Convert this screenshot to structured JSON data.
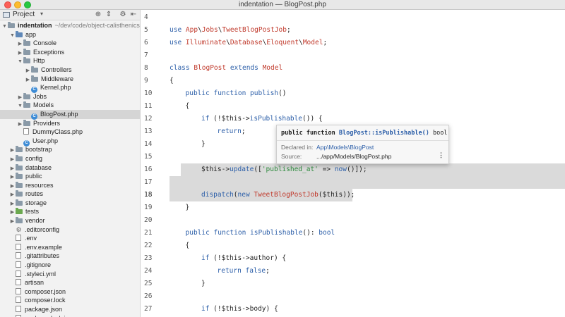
{
  "window": {
    "title": "indentation — BlogPost.php"
  },
  "sidebar": {
    "header_label": "Project",
    "tree": [
      {
        "label": "indentation",
        "suffix": "~/dev/code/object-calisthenics-la",
        "depth": 0,
        "icon": "folder",
        "arrow": "down",
        "bold": true
      },
      {
        "label": "app",
        "depth": 1,
        "icon": "folder-blue",
        "arrow": "down"
      },
      {
        "label": "Console",
        "depth": 2,
        "icon": "folder",
        "arrow": "right"
      },
      {
        "label": "Exceptions",
        "depth": 2,
        "icon": "folder",
        "arrow": "right"
      },
      {
        "label": "Http",
        "depth": 2,
        "icon": "folder",
        "arrow": "down"
      },
      {
        "label": "Controllers",
        "depth": 3,
        "icon": "folder",
        "arrow": "right"
      },
      {
        "label": "Middleware",
        "depth": 3,
        "icon": "folder",
        "arrow": "right"
      },
      {
        "label": "Kernel.php",
        "depth": 3,
        "icon": "class",
        "arrow": ""
      },
      {
        "label": "Jobs",
        "depth": 2,
        "icon": "folder",
        "arrow": "right"
      },
      {
        "label": "Models",
        "depth": 2,
        "icon": "folder",
        "arrow": "down"
      },
      {
        "label": "BlogPost.php",
        "depth": 3,
        "icon": "class",
        "arrow": "",
        "selected": true
      },
      {
        "label": "Providers",
        "depth": 2,
        "icon": "folder",
        "arrow": "right"
      },
      {
        "label": "DummyClass.php",
        "depth": 2,
        "icon": "file",
        "arrow": ""
      },
      {
        "label": "User.php",
        "depth": 2,
        "icon": "class",
        "arrow": ""
      },
      {
        "label": "bootstrap",
        "depth": 1,
        "icon": "folder",
        "arrow": "right"
      },
      {
        "label": "config",
        "depth": 1,
        "icon": "folder",
        "arrow": "right"
      },
      {
        "label": "database",
        "depth": 1,
        "icon": "folder",
        "arrow": "right"
      },
      {
        "label": "public",
        "depth": 1,
        "icon": "folder",
        "arrow": "right"
      },
      {
        "label": "resources",
        "depth": 1,
        "icon": "folder",
        "arrow": "right"
      },
      {
        "label": "routes",
        "depth": 1,
        "icon": "folder",
        "arrow": "right"
      },
      {
        "label": "storage",
        "depth": 1,
        "icon": "folder",
        "arrow": "right"
      },
      {
        "label": "tests",
        "depth": 1,
        "icon": "folder-green",
        "arrow": "right"
      },
      {
        "label": "vendor",
        "depth": 1,
        "icon": "folder",
        "arrow": "right"
      },
      {
        "label": ".editorconfig",
        "depth": 1,
        "icon": "gear",
        "arrow": ""
      },
      {
        "label": ".env",
        "depth": 1,
        "icon": "file",
        "arrow": ""
      },
      {
        "label": ".env.example",
        "depth": 1,
        "icon": "file",
        "arrow": ""
      },
      {
        "label": ".gitattributes",
        "depth": 1,
        "icon": "file",
        "arrow": ""
      },
      {
        "label": ".gitignore",
        "depth": 1,
        "icon": "file",
        "arrow": ""
      },
      {
        "label": ".styleci.yml",
        "depth": 1,
        "icon": "file",
        "arrow": ""
      },
      {
        "label": "artisan",
        "depth": 1,
        "icon": "file",
        "arrow": ""
      },
      {
        "label": "composer.json",
        "depth": 1,
        "icon": "file",
        "arrow": ""
      },
      {
        "label": "composer.lock",
        "depth": 1,
        "icon": "file",
        "arrow": ""
      },
      {
        "label": "package.json",
        "depth": 1,
        "icon": "file",
        "arrow": ""
      },
      {
        "label": "package-lock.json",
        "depth": 1,
        "icon": "file",
        "arrow": ""
      }
    ]
  },
  "editor": {
    "lines": [
      {
        "num": "4",
        "indent": 0,
        "tokens": []
      },
      {
        "num": "5",
        "indent": 0,
        "tokens": [
          [
            "kw",
            "use "
          ],
          [
            "cl",
            "App"
          ],
          [
            "var",
            "\\"
          ],
          [
            "cl",
            "Jobs"
          ],
          [
            "var",
            "\\"
          ],
          [
            "cl",
            "TweetBlogPostJob"
          ],
          [
            "var",
            ";"
          ]
        ]
      },
      {
        "num": "6",
        "indent": 0,
        "tokens": [
          [
            "kw",
            "use "
          ],
          [
            "cl",
            "Illuminate"
          ],
          [
            "var",
            "\\"
          ],
          [
            "cl",
            "Database"
          ],
          [
            "var",
            "\\"
          ],
          [
            "cl",
            "Eloquent"
          ],
          [
            "var",
            "\\"
          ],
          [
            "cl",
            "Model"
          ],
          [
            "var",
            ";"
          ]
        ]
      },
      {
        "num": "7",
        "indent": 0,
        "tokens": []
      },
      {
        "num": "8",
        "indent": 0,
        "tokens": [
          [
            "kw",
            "class "
          ],
          [
            "cl",
            "BlogPost "
          ],
          [
            "kw",
            "extends "
          ],
          [
            "cl",
            "Model"
          ]
        ]
      },
      {
        "num": "9",
        "indent": 0,
        "tokens": [
          [
            "var",
            "{"
          ]
        ]
      },
      {
        "num": "10",
        "indent": 1,
        "tokens": [
          [
            "kw",
            "public function "
          ],
          [
            "fn",
            "publish"
          ],
          [
            "var",
            "()"
          ]
        ]
      },
      {
        "num": "11",
        "indent": 1,
        "tokens": [
          [
            "var",
            "{"
          ]
        ]
      },
      {
        "num": "12",
        "indent": 2,
        "tokens": [
          [
            "kw",
            "if "
          ],
          [
            "var",
            "(!$this->"
          ],
          [
            "fn",
            "isPublishable"
          ],
          [
            "var",
            "()) {"
          ]
        ]
      },
      {
        "num": "13",
        "indent": 3,
        "tokens": [
          [
            "kw",
            "return"
          ],
          [
            "var",
            ";"
          ]
        ]
      },
      {
        "num": "14",
        "indent": 2,
        "tokens": [
          [
            "var",
            "}"
          ]
        ]
      },
      {
        "num": "15",
        "indent": 0,
        "tokens": []
      },
      {
        "num": "16",
        "indent": 2,
        "tokens": [
          [
            "var",
            "$this->"
          ],
          [
            "fn",
            "update"
          ],
          [
            "var",
            "(["
          ],
          [
            "str",
            "'published_at'"
          ],
          [
            "var",
            " => "
          ],
          [
            "fn",
            "now"
          ],
          [
            "var",
            "()]);"
          ]
        ]
      },
      {
        "num": "17",
        "indent": 0,
        "tokens": []
      },
      {
        "num": "18",
        "indent": 2,
        "tokens": [
          [
            "fn",
            "dispatch"
          ],
          [
            "var",
            "("
          ],
          [
            "kw",
            "new "
          ],
          [
            "cl",
            "TweetBlogPostJob"
          ],
          [
            "var",
            "($this));"
          ]
        ]
      },
      {
        "num": "19",
        "indent": 1,
        "tokens": [
          [
            "var",
            "}"
          ]
        ]
      },
      {
        "num": "20",
        "indent": 0,
        "tokens": []
      },
      {
        "num": "21",
        "indent": 1,
        "tokens": [
          [
            "kw",
            "public function "
          ],
          [
            "fn",
            "isPublishable"
          ],
          [
            "var",
            "(): "
          ],
          [
            "kw",
            "bool"
          ]
        ]
      },
      {
        "num": "22",
        "indent": 1,
        "tokens": [
          [
            "var",
            "{"
          ]
        ]
      },
      {
        "num": "23",
        "indent": 2,
        "tokens": [
          [
            "kw",
            "if "
          ],
          [
            "var",
            "(!$this->author) {"
          ]
        ]
      },
      {
        "num": "24",
        "indent": 3,
        "tokens": [
          [
            "kw",
            "return false"
          ],
          [
            "var",
            ";"
          ]
        ]
      },
      {
        "num": "25",
        "indent": 2,
        "tokens": [
          [
            "var",
            "}"
          ]
        ]
      },
      {
        "num": "26",
        "indent": 0,
        "tokens": []
      },
      {
        "num": "27",
        "indent": 2,
        "tokens": [
          [
            "kw",
            "if "
          ],
          [
            "var",
            "(!$this->body) {"
          ]
        ]
      }
    ]
  },
  "tooltip": {
    "sig_keyword": "public function",
    "sig_name": "BlogPost::isPublishable()",
    "sig_type": "bool",
    "declared_label": "Declared in:",
    "declared_value": "App\\Models\\BlogPost",
    "source_label": "Source:",
    "source_value": ".../app/Models/BlogPost.php",
    "more": "⋮"
  }
}
